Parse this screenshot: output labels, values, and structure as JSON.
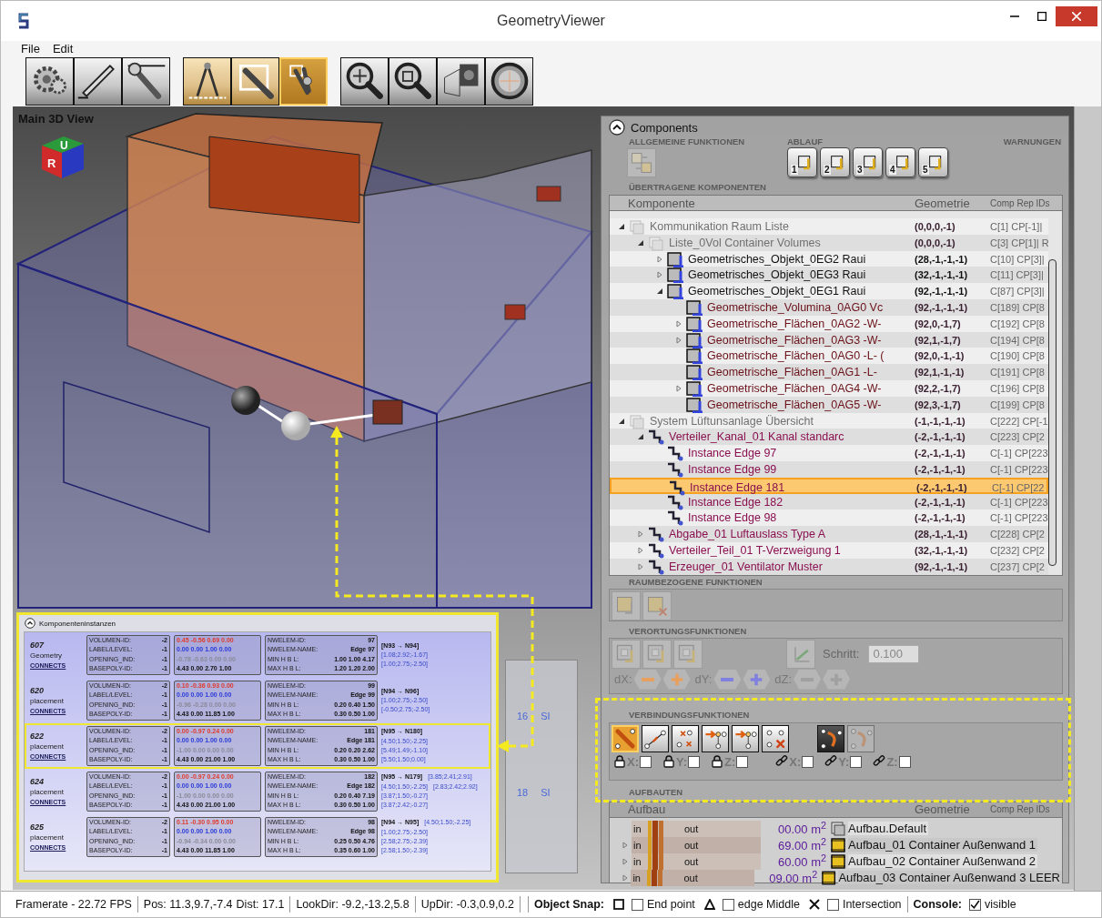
{
  "window": {
    "title": "GeometryViewer"
  },
  "menu": [
    "File",
    "Edit"
  ],
  "toolbar": [
    {
      "active": false,
      "buttons": [
        {
          "kind": "gear",
          "selected": false
        },
        {
          "kind": "pencil",
          "selected": false
        },
        {
          "kind": "wrench",
          "selected": false
        }
      ]
    },
    {
      "active": true,
      "buttons": [
        {
          "kind": "compass",
          "selected": false
        },
        {
          "kind": "frame",
          "selected": false
        },
        {
          "kind": "pliers",
          "selected": true
        }
      ]
    },
    {
      "active": false,
      "buttons": [
        {
          "kind": "zoom",
          "selected": false
        },
        {
          "kind": "zoom-cube",
          "selected": false
        },
        {
          "kind": "cube",
          "selected": false
        },
        {
          "kind": "dial",
          "selected": false
        }
      ]
    }
  ],
  "viewport": {
    "title": "Main 3D View",
    "cube_labels": [
      "U",
      "R"
    ]
  },
  "mini_panel": {
    "labels": [
      "16",
      "SI",
      "18",
      "SI"
    ]
  },
  "instances_panel": {
    "title": "Komponenteninstanzen",
    "instances": [
      {
        "id": "607",
        "type": "Geometry",
        "connects": "CONNECTS",
        "selected": false,
        "fields": [
          {
            "label": "VOLUMEN-ID:",
            "value": "-2"
          },
          {
            "label": "LABEL/LEVEL:",
            "value": "-1"
          },
          {
            "label": "OPENING_IND:",
            "value": "-1"
          },
          {
            "label": "BASEPOLY-ID:",
            "value": "-1"
          }
        ],
        "vectors": [
          "0.45 -0.56 0.69 0.00",
          "0.00 0.00 1.00 0.00",
          "-0.78 -0.63 0.00 0.00",
          "4.43 0.00 2.70 1.00"
        ],
        "nwelem": [
          {
            "label": "NWELEM-ID:",
            "value": "97"
          },
          {
            "label": "NWELEM-NAME:",
            "value": "Edge 97"
          },
          {
            "label": "MIN H B L:",
            "value": "1.00 1.00 4.17"
          },
          {
            "label": "MAX H B L:",
            "value": "1.20 1.20 2.00"
          }
        ],
        "links": [
          [
            "[N93 → N94]"
          ],
          [
            "[1.08;2.92;-1.67]"
          ],
          [
            "[1.00;2.75;-2.50]"
          ]
        ]
      },
      {
        "id": "620",
        "type": "placement",
        "connects": "CONNECTS",
        "selected": false,
        "fields": [
          {
            "label": "VOLUMEN-ID:",
            "value": "-2"
          },
          {
            "label": "LABEL/LEVEL:",
            "value": "-1"
          },
          {
            "label": "OPENING_IND:",
            "value": "-1"
          },
          {
            "label": "BASEPOLY-ID:",
            "value": "-1"
          }
        ],
        "vectors": [
          "0.10 -0.36 0.93 0.00",
          "0.00 0.00 1.00 0.00",
          "-0.96 -0.28 0.00 0.00",
          "4.43 0.00 11.85 1.00"
        ],
        "nwelem": [
          {
            "label": "NWELEM-ID:",
            "value": "99"
          },
          {
            "label": "NWELEM-NAME:",
            "value": "Edge 99"
          },
          {
            "label": "MIN H B L:",
            "value": "0.20 0.40 1.50"
          },
          {
            "label": "MAX H B L:",
            "value": "0.30 0.50 1.00"
          }
        ],
        "links": [
          [
            "[N94 → N96]"
          ],
          [
            "[1.00;2.75;-2.50]"
          ],
          [
            "[-0.50;2.75;-2.50]"
          ]
        ]
      },
      {
        "id": "622",
        "type": "placement",
        "connects": "CONNECTS",
        "selected": true,
        "fields": [
          {
            "label": "VOLUMEN-ID:",
            "value": "-2"
          },
          {
            "label": "LABEL/LEVEL:",
            "value": "-1"
          },
          {
            "label": "OPENING_IND:",
            "value": "-1"
          },
          {
            "label": "BASEPOLY-ID:",
            "value": "-1"
          }
        ],
        "vectors": [
          "0.00 -0.97 0.24 0.00",
          "0.00 0.00 1.00 0.00",
          "-1.00 0.00 0.00 0.00",
          "4.43 0.00 21.00 1.00"
        ],
        "nwelem": [
          {
            "label": "NWELEM-ID:",
            "value": "181"
          },
          {
            "label": "NWELEM-NAME:",
            "value": "Edge 181"
          },
          {
            "label": "MIN H B L:",
            "value": "0.20 0.20 2.62"
          },
          {
            "label": "MAX H B L:",
            "value": "0.30 0.50 1.00"
          }
        ],
        "links": [
          [
            "[N95 → N180]"
          ],
          [
            "[4.50;1.50;-2.25]"
          ],
          [
            "[5.49;1.49;-1.10]"
          ],
          [
            "[5.50;1.50;0.00]"
          ]
        ]
      },
      {
        "id": "624",
        "type": "placement",
        "connects": "CONNECTS",
        "selected": false,
        "fields": [
          {
            "label": "VOLUMEN-ID:",
            "value": "-2"
          },
          {
            "label": "LABEL/LEVEL:",
            "value": "-1"
          },
          {
            "label": "OPENING_IND:",
            "value": "-1"
          },
          {
            "label": "BASEPOLY-ID:",
            "value": "-1"
          }
        ],
        "vectors": [
          "0.00 -0.97 0.24 0.00",
          "0.00 0.00 1.00 0.00",
          "-1.00 0.00 0.00 0.00",
          "4.43 0.00 21.00 1.00"
        ],
        "nwelem": [
          {
            "label": "NWELEM-ID:",
            "value": "182"
          },
          {
            "label": "NWELEM-NAME:",
            "value": "Edge 182"
          },
          {
            "label": "MIN H B L:",
            "value": "0.20 0.40 7.19"
          },
          {
            "label": "MAX H B L:",
            "value": "0.30 0.50 1.00"
          }
        ],
        "links": [
          [
            "[N95 → N179]",
            "[3.85;2.41;2.91]"
          ],
          [
            "[4.50;1.50;-2.25]",
            "[2.83;2.42;2.92]"
          ],
          [
            "[3.87;1.50;-0.27]"
          ],
          [
            "[3.87;2.42;-0.27]"
          ]
        ]
      },
      {
        "id": "625",
        "type": "placement",
        "connects": "CONNECTS",
        "selected": false,
        "fields": [
          {
            "label": "VOLUMEN-ID:",
            "value": "-2"
          },
          {
            "label": "LABEL/LEVEL:",
            "value": "-1"
          },
          {
            "label": "OPENING_IND:",
            "value": "-1"
          },
          {
            "label": "BASEPOLY-ID:",
            "value": "-1"
          }
        ],
        "vectors": [
          "0.11 -0.30 0.95 0.00",
          "0.00 0.00 1.00 0.00",
          "-0.94 -0.34 0.00 0.00",
          "4.43 0.00 11.85 1.00"
        ],
        "nwelem": [
          {
            "label": "NWELEM-ID:",
            "value": "98"
          },
          {
            "label": "NWELEM-NAME:",
            "value": "Edge 98"
          },
          {
            "label": "MIN H B L:",
            "value": "0.25 0.50 4.76"
          },
          {
            "label": "MAX H B L:",
            "value": "0.35 0.60 1.00"
          }
        ],
        "links": [
          [
            "[N94 → N95]",
            "[4.50;1.50;-2.25]"
          ],
          [
            "[1.00;2.75;-2.50]"
          ],
          [
            "[2.58;2.75;-2.39]"
          ],
          [
            "[2.58;1.50;-2.39]"
          ]
        ]
      }
    ]
  },
  "components": {
    "title": "Components",
    "general": {
      "label": "ALLGEMEINE FUNKTIONEN"
    },
    "flow": {
      "label": "ABLAUF",
      "steps": [
        "1",
        "2",
        "3",
        "4",
        "5"
      ]
    },
    "warnings": {
      "label": "WARNUNGEN"
    },
    "transferred": {
      "label": "ÜBERTRAGENE KOMPONENTEN",
      "columns": [
        "Komponente",
        "Geometrie",
        "Comp Rep IDs"
      ],
      "rows": [
        {
          "kind": "group",
          "name": "Kommunikation Raum Liste",
          "geometry": "(0,0,0,-1)",
          "ids": "C[1] CP[-1]|",
          "expanded": true,
          "selected": false,
          "children": [
            {
              "kind": "group",
              "name": "Liste_0Vol Container Volumes",
              "geometry": "(0,0,0,-1)",
              "ids": "C[3] CP[1]| R",
              "expanded": true,
              "selected": false,
              "children": [
                {
                  "kind": "object",
                  "name": "Geometrisches_Objekt_0EG2 Raui",
                  "geometry": "(28,-1,-1,-1)",
                  "ids": "C[10] CP[3]|",
                  "expanded": false,
                  "selected": false
                },
                {
                  "kind": "object",
                  "name": "Geometrisches_Objekt_0EG3 Raui",
                  "geometry": "(32,-1,-1,-1)",
                  "ids": "C[11] CP[3]|",
                  "expanded": false,
                  "selected": false
                },
                {
                  "kind": "object",
                  "name": "Geometrisches_Objekt_0EG1 Raui",
                  "geometry": "(92,-1,-1,-1)",
                  "ids": "C[87] CP[3]|",
                  "expanded": true,
                  "selected": false,
                  "children": [
                    {
                      "kind": "geometry",
                      "name": "Geometrische_Volumina_0AG0 Vc",
                      "geometry": "(92,-1,-1,-1)",
                      "ids": "C[189] CP[8",
                      "selected": false
                    },
                    {
                      "kind": "geometry",
                      "name": "Geometrische_Flächen_0AG2 -W-",
                      "geometry": "(92,0,-1,7)",
                      "ids": "C[192] CP[8",
                      "expanded": false,
                      "selected": false
                    },
                    {
                      "kind": "geometry",
                      "name": "Geometrische_Flächen_0AG3 -W-",
                      "geometry": "(92,1,-1,7)",
                      "ids": "C[194] CP[8",
                      "expanded": false,
                      "selected": false
                    },
                    {
                      "kind": "geometry",
                      "name": "Geometrische_Flächen_0AG0 -L- (",
                      "geometry": "(92,0,-1,-1)",
                      "ids": "C[190] CP[8",
                      "selected": false
                    },
                    {
                      "kind": "geometry",
                      "name": "Geometrische_Flächen_0AG1 -L-",
                      "geometry": "(92,1,-1,-1)",
                      "ids": "C[191] CP[8",
                      "selected": false
                    },
                    {
                      "kind": "geometry",
                      "name": "Geometrische_Flächen_0AG4 -W-",
                      "geometry": "(92,2,-1,7)",
                      "ids": "C[196] CP[8",
                      "expanded": false,
                      "selected": false
                    },
                    {
                      "kind": "geometry",
                      "name": "Geometrische_Flächen_0AG5 -W-",
                      "geometry": "(92,3,-1,7)",
                      "ids": "C[199] CP[8",
                      "selected": false
                    }
                  ]
                }
              ]
            }
          ]
        },
        {
          "kind": "group",
          "name": "System Lüftunsanlage Übersicht",
          "geometry": "(-1,-1,-1,-1)",
          "ids": "C[222] CP[-1",
          "expanded": true,
          "selected": false,
          "children": [
            {
              "kind": "system",
              "name": "Verteiler_Kanal_01 Kanal standarc",
              "geometry": "(-2,-1,-1,-1)",
              "ids": "C[223] CP[2",
              "expanded": true,
              "selected": false,
              "children": [
                {
                  "kind": "edge",
                  "name": "Instance Edge 97",
                  "geometry": "(-2,-1,-1,-1)",
                  "ids": "C[-1] CP[223",
                  "selected": false
                },
                {
                  "kind": "edge",
                  "name": "Instance Edge 99",
                  "geometry": "(-2,-1,-1,-1)",
                  "ids": "C[-1] CP[223",
                  "selected": false
                },
                {
                  "kind": "edge",
                  "name": "Instance Edge 181",
                  "geometry": "(-2,-1,-1,-1)",
                  "ids": "C[-1] CP[22",
                  "selected": true
                },
                {
                  "kind": "edge",
                  "name": "Instance Edge 182",
                  "geometry": "(-2,-1,-1,-1)",
                  "ids": "C[-1] CP[223",
                  "selected": false
                },
                {
                  "kind": "edge",
                  "name": "Instance Edge 98",
                  "geometry": "(-2,-1,-1,-1)",
                  "ids": "C[-1] CP[223",
                  "selected": false
                }
              ]
            },
            {
              "kind": "system",
              "name": "Abgabe_01 Luftauslass Type A",
              "geometry": "(28,-1,-1,-1)",
              "ids": "C[228] CP[2",
              "expanded": false,
              "selected": false
            },
            {
              "kind": "system",
              "name": "Verteiler_Teil_01 T-Verzweigung 1",
              "geometry": "(32,-1,-1,-1)",
              "ids": "C[232] CP[2",
              "expanded": false,
              "selected": false
            },
            {
              "kind": "system",
              "name": "Erzeuger_01 Ventilator Muster",
              "geometry": "(92,-1,-1,-1)",
              "ids": "C[237] CP[2",
              "expanded": false,
              "selected": false
            }
          ]
        }
      ]
    },
    "room": {
      "label": "RAUMBEZOGENE FUNKTIONEN"
    },
    "placement": {
      "label": "VERORTUNGSFUNKTIONEN",
      "step_label": "Schritt:",
      "step_value": "0.100",
      "axes": [
        "dX:",
        "dY:",
        "dZ:"
      ]
    },
    "connection": {
      "label": "VERBINDUNGSFUNKTIONEN",
      "tools": [
        {
          "kind": "pin",
          "selected": true,
          "disabled": false
        },
        {
          "kind": "line",
          "selected": false,
          "disabled": false
        },
        {
          "kind": "cross",
          "selected": false,
          "disabled": false
        },
        {
          "kind": "arrow",
          "selected": false,
          "disabled": false
        },
        {
          "kind": "arrow",
          "selected": false,
          "disabled": false
        },
        {
          "kind": "delete",
          "selected": false,
          "disabled": false
        },
        {
          "kind": "rotate",
          "selected": false,
          "disabled": false
        },
        {
          "kind": "rotate",
          "selected": false,
          "disabled": true
        }
      ],
      "locks": [
        {
          "kind": "lock",
          "label": "X:",
          "checked": false
        },
        {
          "kind": "lock",
          "label": "Y:",
          "checked": false
        },
        {
          "kind": "lock",
          "label": "Z:",
          "checked": false
        },
        {
          "kind": "link",
          "label": "X:",
          "checked": false
        },
        {
          "kind": "link",
          "label": "Y:",
          "checked": false
        },
        {
          "kind": "link",
          "label": "Z:",
          "checked": false
        }
      ]
    },
    "structures": {
      "label": "AUFBAUTEN",
      "columns": [
        "Aufbau",
        "Geometrie",
        "Comp Rep IDs"
      ],
      "rows": [
        {
          "in": "in",
          "out": "out",
          "area": "00.00 m$^{2}$",
          "name": "Aufbau.Default",
          "kind": "default"
        },
        {
          "in": "in",
          "out": "out",
          "area": "69.00 m$^{2}$",
          "name": "Aufbau_01 Container Außenwand 1",
          "kind": "wall",
          "expanded": false
        },
        {
          "in": "in",
          "out": "out",
          "area": "60.00 m$^{2}$",
          "name": "Aufbau_02 Container Außenwand 2",
          "kind": "wall",
          "expanded": false
        },
        {
          "in": "in",
          "out": "out",
          "area": "09.00 m$^{2}$",
          "name": "Aufbau_03 Container Außenwand 3 LEER",
          "kind": "wall",
          "expanded": false
        }
      ]
    }
  },
  "status_bar": {
    "segments": [
      [
        "Framerate - 22.72 FPS"
      ],
      [
        "Pos: 11.3,9.7,-7.4",
        "Dist: 17.1"
      ],
      [
        "LookDir: -9.2,-13.2,5.8"
      ],
      [
        "UpDir: -0.3,0.9,0.2"
      ]
    ],
    "snap": {
      "label": "Object Snap:",
      "options": [
        {
          "kind": "square",
          "label": "End point",
          "checked": false
        },
        {
          "kind": "triangle",
          "label": "edge Middle",
          "checked": false
        },
        {
          "kind": "cross",
          "label": "Intersection",
          "checked": false
        }
      ]
    },
    "console": {
      "label": "Console:",
      "option": {
        "label": "visible",
        "checked": true
      }
    }
  }
}
